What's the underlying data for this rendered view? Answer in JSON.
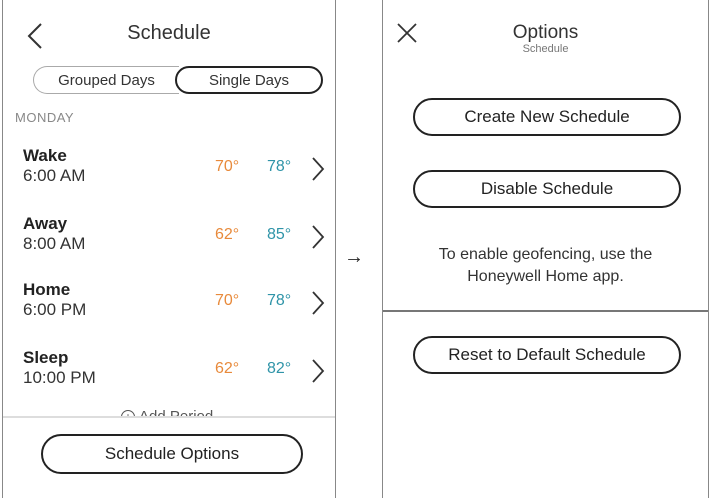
{
  "schedule_screen": {
    "title": "Schedule",
    "segments": [
      {
        "label": "Grouped Days",
        "selected": false
      },
      {
        "label": "Single Days",
        "selected": true
      }
    ],
    "day": "MONDAY",
    "periods": [
      {
        "name": "Wake",
        "time": "6:00 AM",
        "heat": "70°",
        "cool": "78°"
      },
      {
        "name": "Away",
        "time": "8:00 AM",
        "heat": "62°",
        "cool": "85°"
      },
      {
        "name": "Home",
        "time": "6:00 PM",
        "heat": "70°",
        "cool": "78°"
      },
      {
        "name": "Sleep",
        "time": "10:00 PM",
        "heat": "62°",
        "cool": "82°"
      }
    ],
    "add_period_label": "Add Period",
    "options_button": "Schedule Options"
  },
  "flow_arrow": "→",
  "options_screen": {
    "title": "Options",
    "subtitle": "Schedule",
    "create_button": "Create New Schedule",
    "disable_button": "Disable Schedule",
    "geofence_line1": "To enable geofencing, use the",
    "geofence_line2": "Honeywell Home app.",
    "reset_button": "Reset to Default Schedule"
  },
  "colors": {
    "heat": "#e88a3b",
    "cool": "#2f94a8"
  }
}
